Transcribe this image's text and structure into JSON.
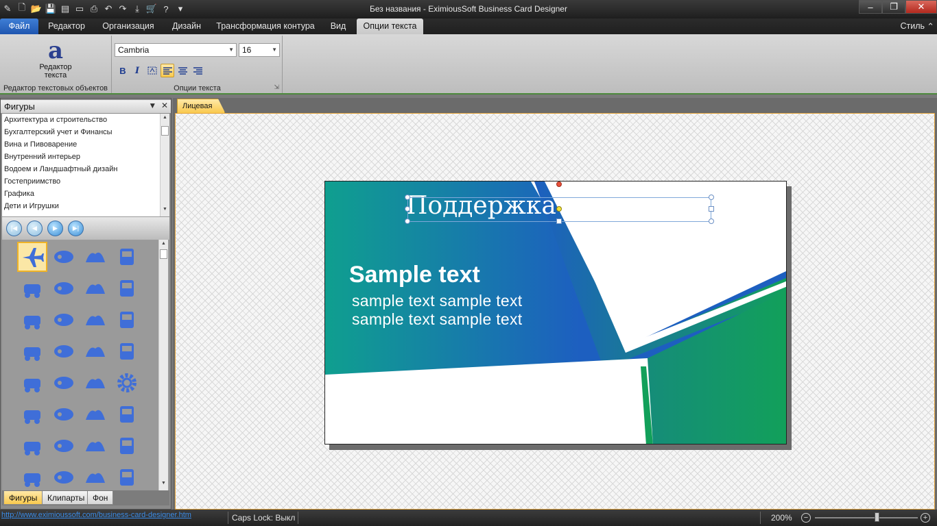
{
  "window": {
    "title": "Без названия - EximiousSoft Business Card Designer",
    "controls": [
      "–",
      "❐",
      "✕"
    ]
  },
  "ribbon_tabs": {
    "file": "Файл",
    "items": [
      "Редактор",
      "Организация",
      "Дизайн",
      "Трансформация контура",
      "Вид",
      "Опции текста"
    ],
    "active": "Опции текста",
    "style": "Стиль"
  },
  "ribbon": {
    "text_editor_group": {
      "glyph": "a",
      "button_label_1": "Редактор",
      "button_label_2": "текста",
      "label": "Редактор текстовых объектов"
    },
    "text_options_group": {
      "font": "Cambria",
      "size": "16",
      "bold": "B",
      "italic": "I",
      "label": "Опции текста"
    }
  },
  "left_pane": {
    "title": "Фигуры",
    "categories": [
      "Архитектура и строительство",
      "Бухгалтерский учет и Финансы",
      "Вина и Пивоварение",
      "Внутренний интерьер",
      "Водоем и Ландшафтный дизайн",
      "Гостеприимство",
      "Графика",
      "Дети и Игрушки"
    ],
    "bottom_tabs": [
      "Фигуры",
      "Клипарты",
      "Фон"
    ],
    "active_bottom_tab": "Фигуры",
    "icon_color": "#3f6ed8"
  },
  "document": {
    "tab": "Лицевая",
    "card": {
      "heading": "Поддержка кириллицы",
      "title": "Sample text",
      "line1": "sample text sample text",
      "line2": "sample text sample text",
      "colors": {
        "teal": "#0f9f8f",
        "blue": "#1d5fc0",
        "green": "#12a05a"
      }
    }
  },
  "status": {
    "url": "http://www.eximioussoft.com/business-card-designer.htm",
    "caps_lock": "Caps Lock: Выкл",
    "zoom": "200%",
    "zoom_fraction": 0.6
  }
}
